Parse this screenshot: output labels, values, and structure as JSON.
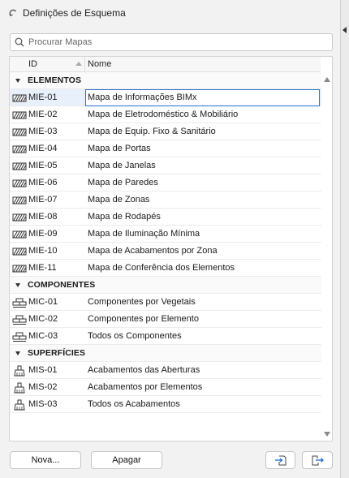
{
  "window": {
    "title": "Definições de Esquema"
  },
  "search": {
    "placeholder": "Procurar Mapas",
    "value": ""
  },
  "table": {
    "columns": {
      "id": "ID",
      "name": "Nome"
    },
    "groups": [
      {
        "label": "ELEMENTOS",
        "icon": "hatch-icon",
        "items": [
          {
            "id": "MIE-01",
            "name": "Mapa de Informações BIMx",
            "selected": true
          },
          {
            "id": "MIE-02",
            "name": "Mapa de Eletrodoméstico & Mobiliário"
          },
          {
            "id": "MIE-03",
            "name": "Mapa de Equip. Fixo & Sanitário"
          },
          {
            "id": "MIE-04",
            "name": "Mapa de Portas"
          },
          {
            "id": "MIE-05",
            "name": "Mapa de Janelas"
          },
          {
            "id": "MIE-06",
            "name": "Mapa de Paredes"
          },
          {
            "id": "MIE-07",
            "name": "Mapa de Zonas"
          },
          {
            "id": "MIE-08",
            "name": "Mapa de Rodapés"
          },
          {
            "id": "MIE-09",
            "name": "Mapa de Iluminação Mínima"
          },
          {
            "id": "MIE-10",
            "name": "Mapa de Acabamentos por Zona"
          },
          {
            "id": "MIE-11",
            "name": "Mapa de Conferência dos Elementos"
          }
        ]
      },
      {
        "label": "COMPONENTES",
        "icon": "bricks-icon",
        "items": [
          {
            "id": "MIC-01",
            "name": "Componentes por Vegetais"
          },
          {
            "id": "MIC-02",
            "name": "Componentes por Elemento"
          },
          {
            "id": "MIC-03",
            "name": "Todos os Componentes"
          }
        ]
      },
      {
        "label": "SUPERFÍCIES",
        "icon": "brush-icon",
        "items": [
          {
            "id": "MIS-01",
            "name": "Acabamentos das Aberturas"
          },
          {
            "id": "MIS-02",
            "name": "Acabamentos por Elementos"
          },
          {
            "id": "MIS-03",
            "name": "Todos os Acabamentos"
          }
        ]
      }
    ]
  },
  "buttons": {
    "new": "Nova...",
    "delete": "Apagar",
    "import": "import-icon",
    "export": "export-icon"
  },
  "colors": {
    "selection_border": "#2a6fd1",
    "selection_bg": "#e8f0fb"
  }
}
